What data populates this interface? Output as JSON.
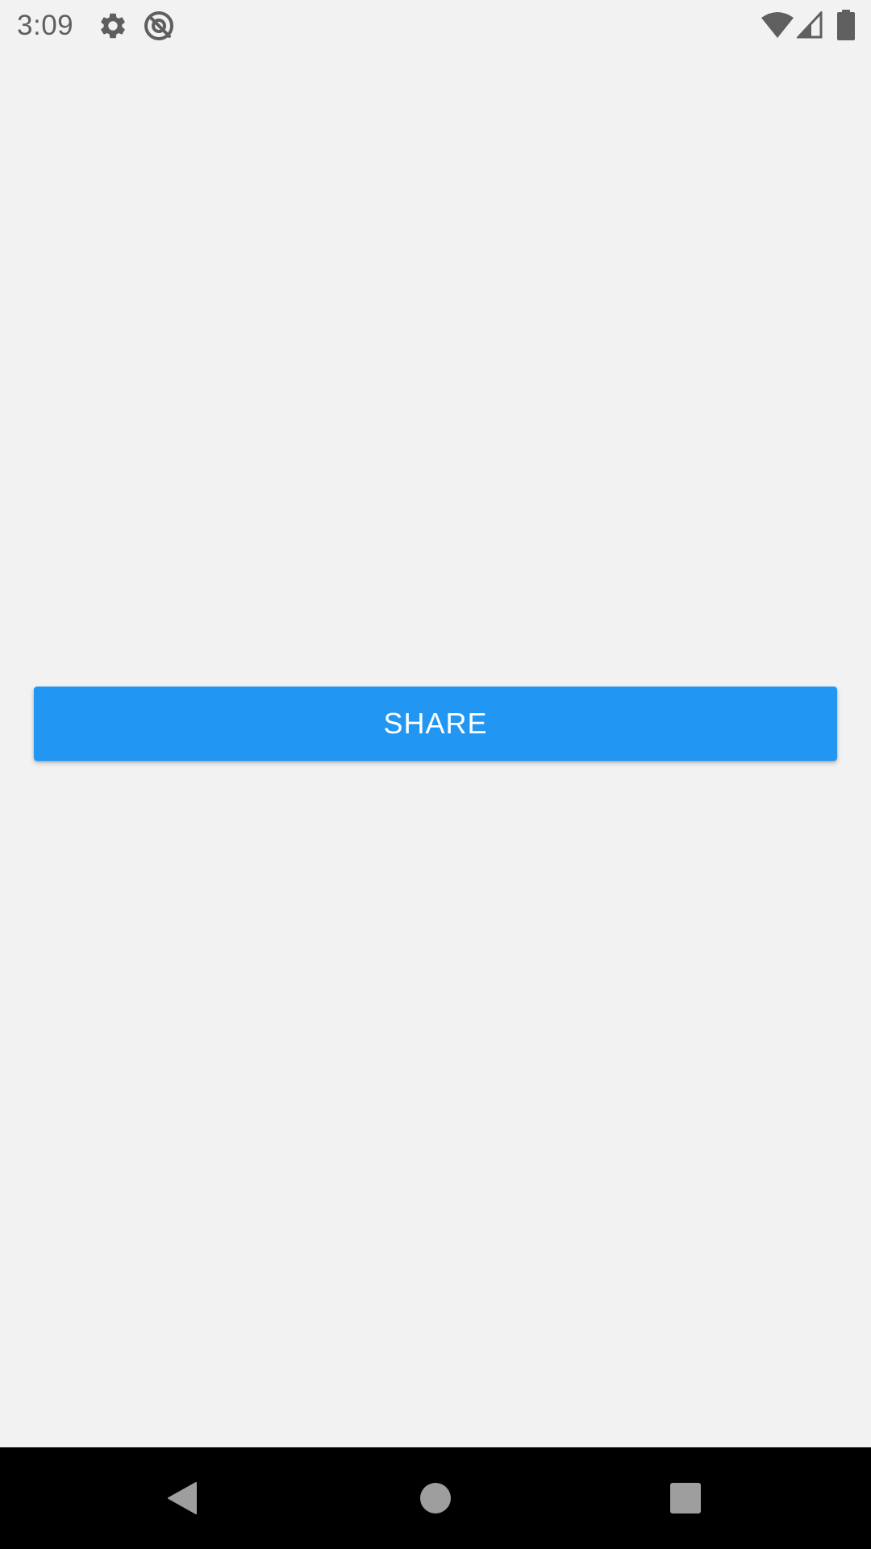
{
  "status_bar": {
    "time": "3:09",
    "icons": [
      "gear-icon",
      "vpn-icon",
      "wifi-icon",
      "signal-icon",
      "battery-icon"
    ],
    "icon_color": "#5f5f5f"
  },
  "main": {
    "share_button": {
      "label": "SHARE",
      "color": "#2196f3",
      "text_color": "#ffffff"
    }
  },
  "nav_bar": {
    "buttons": [
      "back-icon",
      "home-icon",
      "recents-icon"
    ],
    "icon_color": "#9e9e9e",
    "background": "#000000"
  },
  "background": "#f2f2f2"
}
